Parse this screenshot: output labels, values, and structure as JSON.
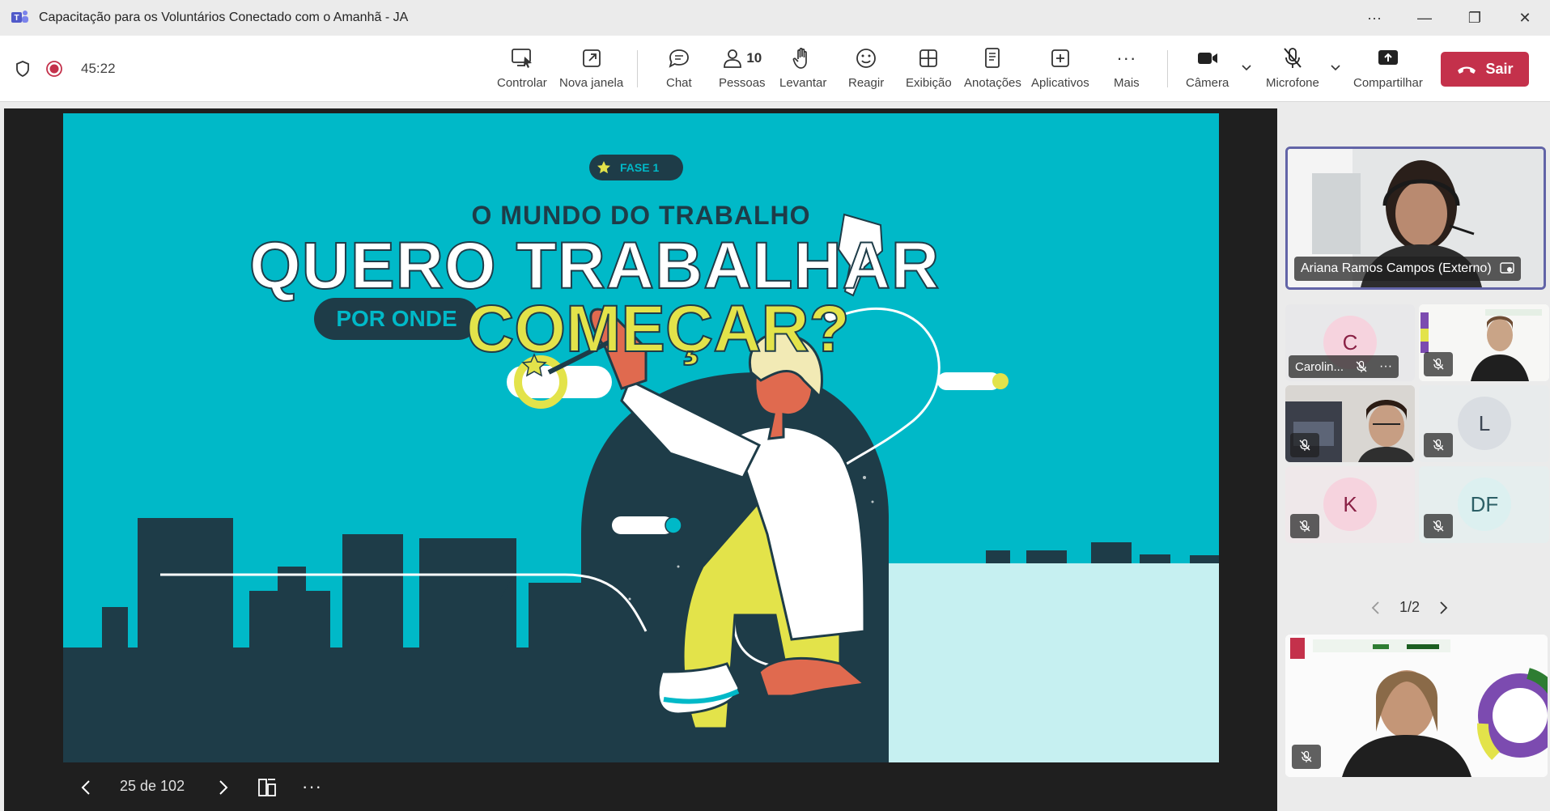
{
  "window": {
    "title": "Capacitação para os Voluntários Conectado com o Amanhã - JA",
    "more": "···",
    "minimize": "—",
    "restore": "❐",
    "close": "✕"
  },
  "toolbar": {
    "timer": "45:22",
    "controlar": "Controlar",
    "nova_janela": "Nova janela",
    "chat": "Chat",
    "pessoas": "Pessoas",
    "pessoas_count": "10",
    "levantar": "Levantar",
    "reagir": "Reagir",
    "exibicao": "Exibição",
    "anotacoes": "Anotações",
    "aplicativos": "Aplicativos",
    "mais": "Mais",
    "camera": "Câmera",
    "microfone": "Microfone",
    "compartilhar": "Compartilhar",
    "sair": "Sair"
  },
  "slide": {
    "badge": "FASE 1",
    "subtitle": "O MUNDO DO TRABALHO",
    "title_line1": "QUERO TRABALHAR",
    "pill": "POR ONDE",
    "title_line2": "COMEÇAR?"
  },
  "slide_nav": {
    "counter": "25 de 102",
    "more": "···"
  },
  "participants": {
    "main_name": "Ariana Ramos Campos (Externo)",
    "c_initial": "C",
    "c_name": "Carolin...",
    "c_more": "···",
    "l_initial": "L",
    "k_initial": "K",
    "df_initial": "DF",
    "pager": "1/2"
  },
  "colors": {
    "accent": "#6264a7",
    "leave": "#c4314b",
    "slide_bg": "#00b9c8",
    "slide_yellow": "#e3e34a",
    "slide_dark": "#1e3c48"
  }
}
